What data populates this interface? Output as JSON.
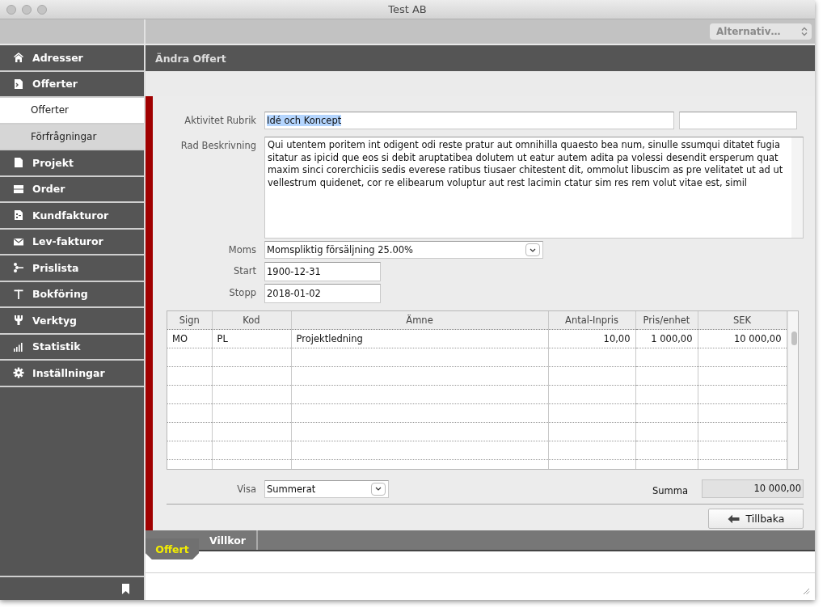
{
  "window": {
    "title": "Test AB"
  },
  "toolbar": {
    "options_popup": {
      "value": "Alternativ…"
    }
  },
  "sidebar": {
    "items": [
      {
        "label": "Adresser",
        "selected": false
      },
      {
        "label": "Offerter",
        "selected": false,
        "children": [
          {
            "label": "Offerter",
            "selected": true
          },
          {
            "label": "Förfrågningar",
            "selected": false
          }
        ]
      },
      {
        "label": "Projekt",
        "selected": false
      },
      {
        "label": "Order",
        "selected": false
      },
      {
        "label": "Kundfakturor",
        "selected": false
      },
      {
        "label": "Lev-fakturor",
        "selected": false
      },
      {
        "label": "Prislista",
        "selected": false
      },
      {
        "label": "Bokföring",
        "selected": false
      },
      {
        "label": "Verktyg",
        "selected": false
      },
      {
        "label": "Statistik",
        "selected": false
      },
      {
        "label": "Inställningar",
        "selected": false
      }
    ]
  },
  "panel": {
    "title": "Ändra Offert",
    "rubrik": {
      "label": "Aktivitet Rubrik",
      "value": "Idé och Koncept",
      "text_selected": true
    },
    "beskrivning": {
      "label": "Rad Beskrivning",
      "value": "Qui utentem poritem int odigent odi reste pratur aut omnihilla quaesto bea num, sinulle ssumqui ditatet fugia sitatur as ipicid que eos si debit aruptatibea dolutem ut eatur autem adita pa volessi desendit ersperum quat maxim sinci corerchiciis sedis everese ratibus tiusaer chitestent dit, ommolut libuscim as pre velitatet ut ad ut vellestrum quidenet, cor re elibearum voluptur aut rest lacimin ctatur sim res rem volut vitae est, simil"
    },
    "moms": {
      "label": "Moms",
      "value": "Momspliktig försäljning 25.00%"
    },
    "start": {
      "label": "Start",
      "value": "1900-12-31"
    },
    "stopp": {
      "label": "Stopp",
      "value": "2018-01-02"
    },
    "table": {
      "columns": [
        "Sign",
        "Kod",
        "Ämne",
        "Antal-Inpris",
        "Pris/enhet",
        "SEK"
      ],
      "rows": [
        [
          "MO",
          "PL",
          "Projektledning",
          "10,00",
          "1 000,00",
          "10 000,00"
        ]
      ]
    },
    "visa": {
      "label": "Visa",
      "value": "Summerat"
    },
    "summa": {
      "label": "Summa",
      "value": "10 000,00"
    },
    "back_button": {
      "label": "Tillbaka"
    }
  },
  "tabs": [
    {
      "label": "Offert",
      "selected": true
    },
    {
      "label": "Villkor",
      "selected": false
    }
  ]
}
